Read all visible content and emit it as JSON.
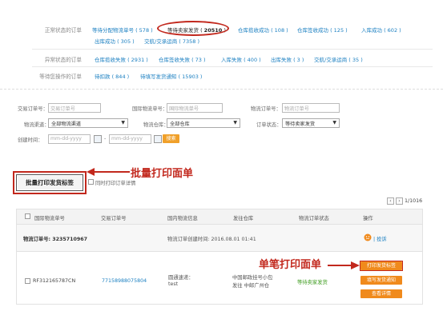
{
  "status": {
    "normal_label": "正常状态的订单",
    "normal_items": [
      {
        "label": "等待分配物流单号",
        "count": "578"
      },
      {
        "label": "等待卖家发货",
        "count": "20510"
      },
      {
        "label": "仓库揽收成功",
        "count": "108"
      },
      {
        "label": "仓库签收成功",
        "count": "125"
      },
      {
        "label": "入库成功",
        "count": "602"
      },
      {
        "label": "出库成功",
        "count": "305"
      },
      {
        "label": "交航/交承运商",
        "count": "7358"
      }
    ],
    "abnormal_label": "异常状态的订单",
    "abnormal_items": [
      {
        "label": "仓库揽收失败",
        "count": "2931"
      },
      {
        "label": "仓库签收失败",
        "count": "73"
      },
      {
        "label": "入库失败",
        "count": "400"
      },
      {
        "label": "出库失败",
        "count": "3"
      },
      {
        "label": "交航/交承运商",
        "count": "35"
      }
    ],
    "pending_label": "等待您操作的订单",
    "pending_items": [
      {
        "label": "待扣款",
        "count": "844"
      },
      {
        "label": "待填写发货通知",
        "count": "15903"
      }
    ]
  },
  "filters": {
    "trade_no_label": "交易订单号：",
    "trade_no_placeholder": "交易订单号",
    "intl_no_label": "国际物流单号：",
    "intl_no_placeholder": "国际物流单号",
    "logi_order_label": "物流订单号：",
    "logi_order_placeholder": "物流订单号",
    "channel_label": "物流渠道：",
    "channel_value": "全部物流渠道",
    "warehouse_label": "物流仓库：",
    "warehouse_value": "全部仓库",
    "order_status_label": "订单状态：",
    "order_status_value": "等待卖家发货",
    "created_label": "创建时间：",
    "date_placeholder": "mm-dd-yyyy",
    "date_sep": "-",
    "search_label": "搜索"
  },
  "batch": {
    "button_label": "批量打印发货标签",
    "checkbox_label": "同时打印订单详情",
    "annotation": "批量打印面单"
  },
  "pager": {
    "prev": "‹",
    "next": "›",
    "page_info": "1/1016"
  },
  "table": {
    "headers": [
      "国际物流单号",
      "交易订单号",
      "国内物流信息",
      "发往仓库",
      "物流订单状态",
      "操作"
    ],
    "group": {
      "order_no_label": "物流订单号: 3235710967",
      "created_time": "物流订单创建时间: 2016.08.01 01:41",
      "complain": "投诉"
    },
    "row": {
      "intl_no": "RF312165787CN",
      "trade_no": "77158988075804",
      "domestic_line1": "圆通速递：",
      "domestic_line2": "test",
      "warehouse_line1": "中国邮政挂号小包",
      "warehouse_line2": "发往 中邮广州仓",
      "status": "等待卖家发货",
      "action_buttons": [
        "打印发货标签",
        "填写发货通知",
        "查看详情"
      ]
    }
  },
  "single_annotation": "单笔打印面单",
  "colors": {
    "link": "#1a7fc1",
    "annotation_red": "#c2281d",
    "orange_button": "#f08a1c",
    "status_green": "#3a9a1a"
  },
  "icons": {
    "calendar": "calendar-icon",
    "complain": "complain-icon",
    "dropdown": "chevron-down-icon"
  }
}
